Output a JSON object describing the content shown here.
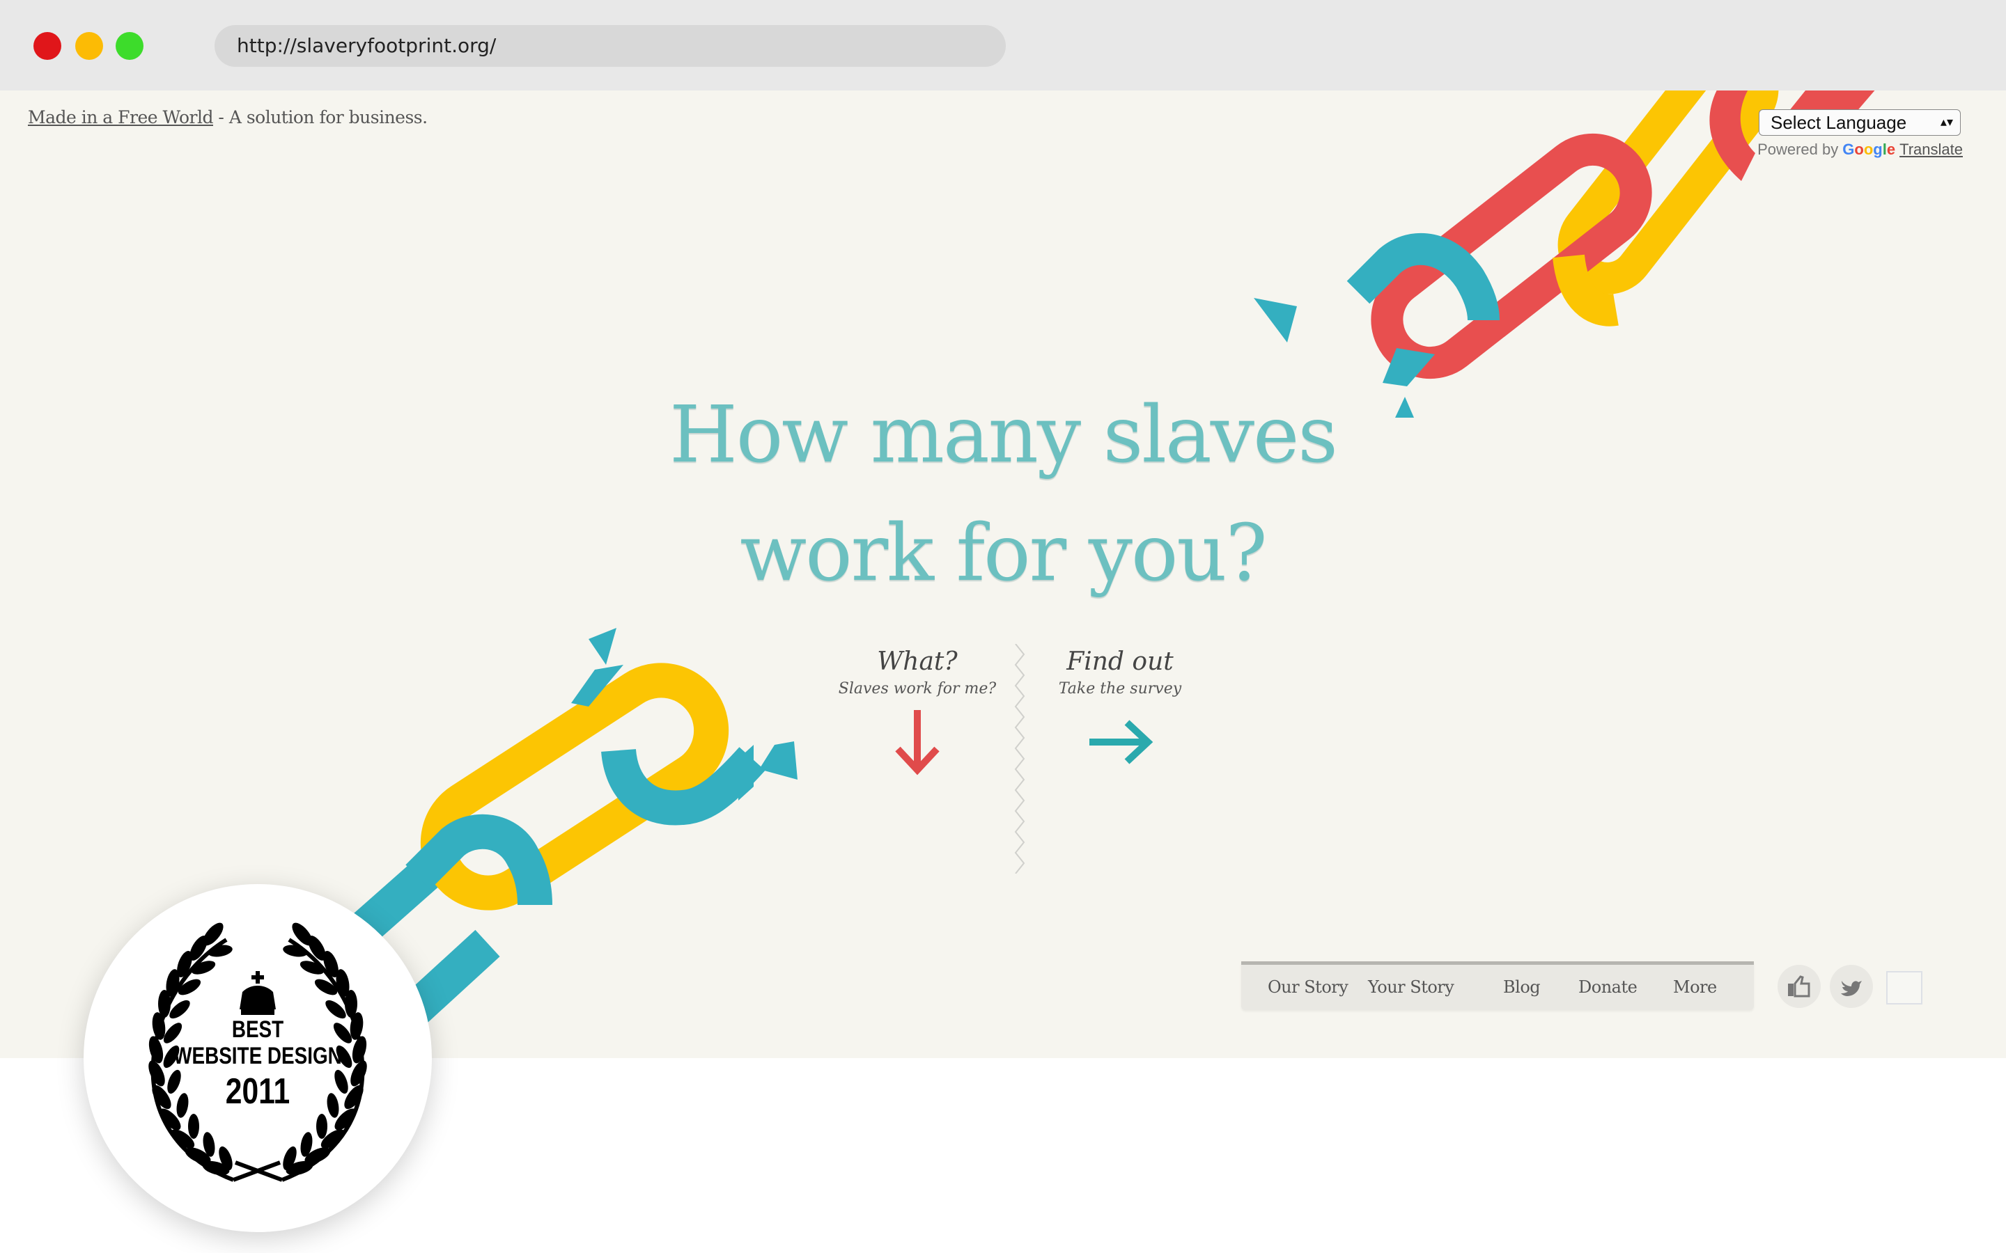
{
  "browser": {
    "url": "http://slaveryfootprint.org/"
  },
  "header": {
    "tagline_link": "Made in a Free World",
    "tagline_rest": " - A solution for business."
  },
  "translate": {
    "select_label": "Select Language",
    "select_arrows": "▴▾",
    "powered_by": "Powered by",
    "google_letters": [
      "G",
      "o",
      "o",
      "g",
      "l",
      "e"
    ],
    "translate_link": "Translate"
  },
  "hero": {
    "line1": "How many slaves",
    "line2": "work for you?"
  },
  "cta": {
    "what": {
      "title": "What?",
      "subtitle": "Slaves work for me?",
      "icon": "arrow-down-icon",
      "color": "#e04b4b"
    },
    "find": {
      "title": "Find out",
      "subtitle": "Take the survey",
      "icon": "arrow-right-icon",
      "color": "#2aa9ad"
    }
  },
  "nav": {
    "items": [
      "Our Story",
      "Your Story",
      "Blog",
      "Donate",
      "More"
    ]
  },
  "social": {
    "like_icon": "thumbs-up-icon",
    "twitter_icon": "twitter-bird-icon"
  },
  "badge": {
    "line1": "BEST",
    "line2": "WEBSITE DESIGN",
    "line3": "2011",
    "icon": "crown-icon"
  },
  "colors": {
    "background": "#f6f5ef",
    "teal": "#34afc0",
    "yellow": "#fcc503",
    "red": "#e84f4f",
    "headline": "#6cc0c0"
  }
}
